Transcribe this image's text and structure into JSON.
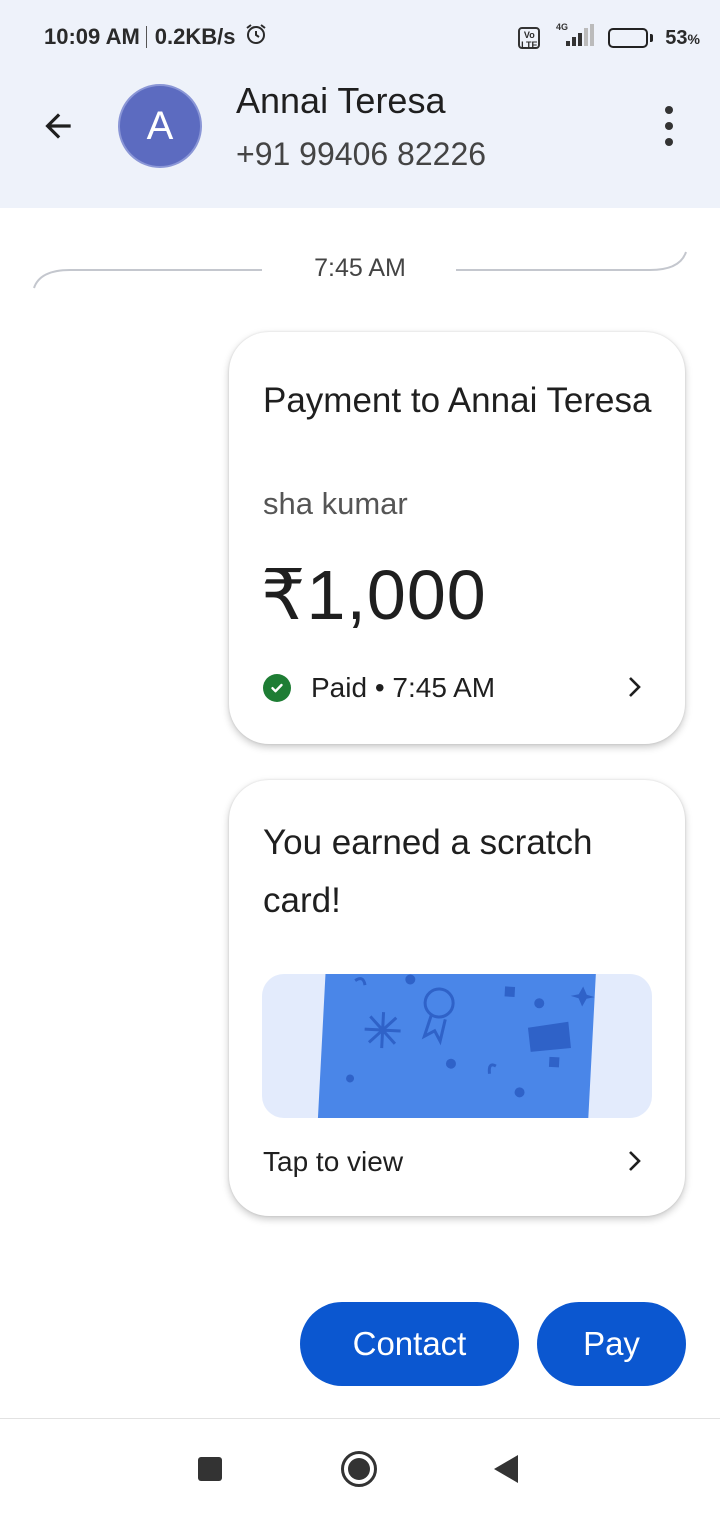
{
  "status_bar": {
    "time": "10:09 AM",
    "speed": "0.2KB/s",
    "alarm_icon": "alarm-clock-icon",
    "network": "4G",
    "volte": "Vo\nLTE",
    "battery_percent": "53",
    "battery_unit": "%",
    "battery_level": 0.53
  },
  "header": {
    "avatar_letter": "A",
    "contact_name": "Annai Teresa",
    "contact_phone": "+91 99406 82226",
    "back_icon": "arrow-back-icon",
    "menu_icon": "more-vert-icon"
  },
  "conversation": {
    "time_divider": "7:45 AM"
  },
  "payment_card": {
    "title": "Payment to Annai Teresa",
    "sender": "sha kumar",
    "amount": "₹1,000",
    "status": "Paid • 7:45 AM",
    "status_icon": "check-circle-icon",
    "chevron_icon": "chevron-right-icon"
  },
  "scratch_card": {
    "title": "You earned a scratch card!",
    "action": "Tap to view",
    "chevron_icon": "chevron-right-icon"
  },
  "actions": {
    "contact_label": "Contact",
    "pay_label": "Pay"
  },
  "colors": {
    "header_bg": "#eef2fa",
    "primary_button": "#0b57d0",
    "avatar": "#5c6bc0",
    "paid_green": "#1e7d34",
    "scratch_card": "#4a86e8",
    "scratch_banner": "#e3ebfc"
  }
}
